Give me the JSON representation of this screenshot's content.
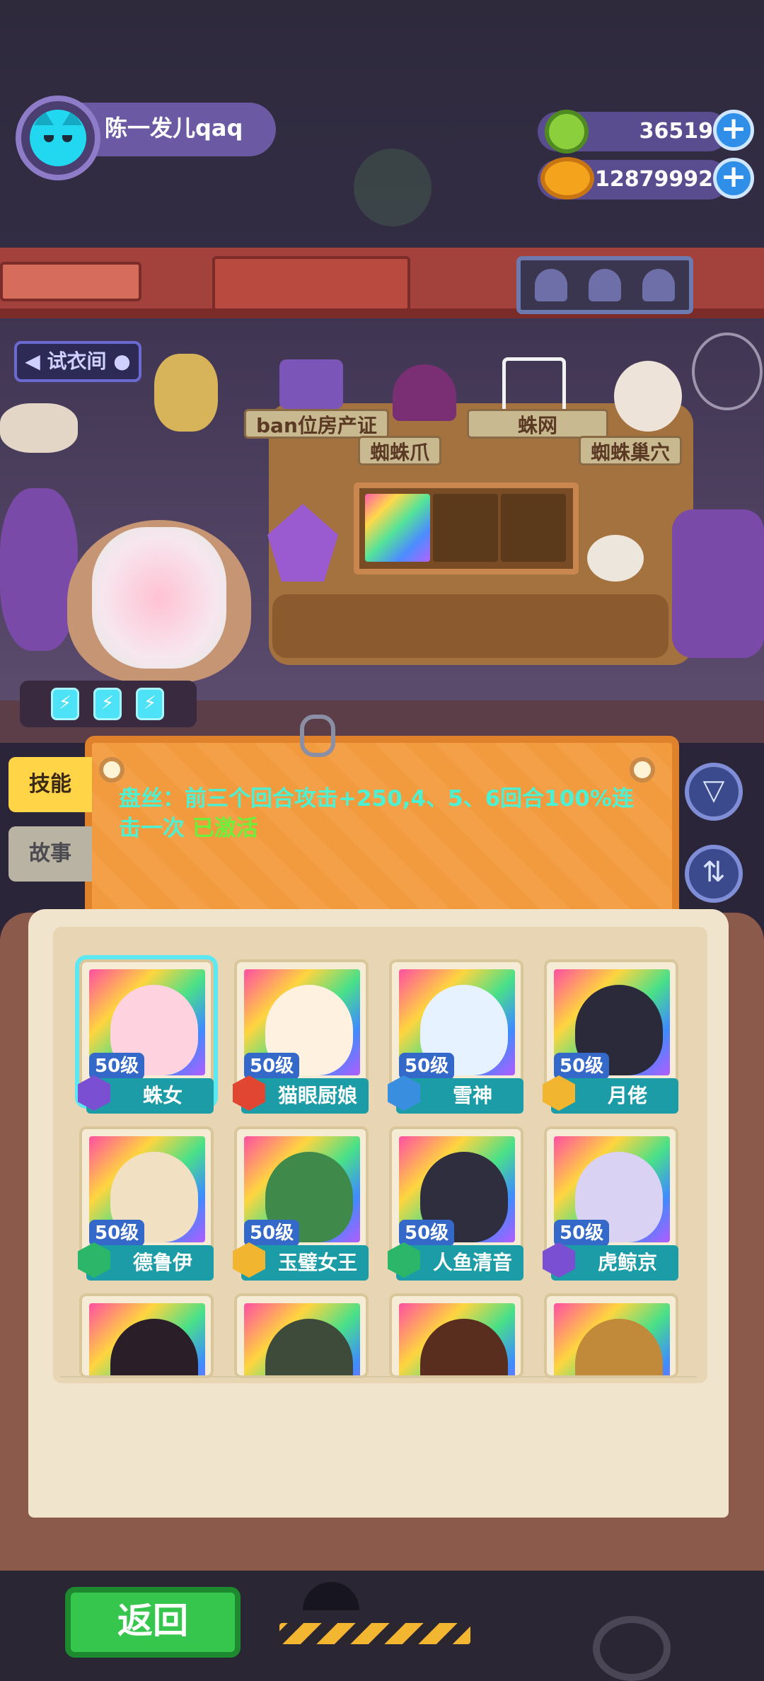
{
  "player": {
    "name": "陈一发儿qaq"
  },
  "currency": {
    "gems": "36519",
    "coins": "12879992",
    "plus_symbol": "+"
  },
  "shop": {
    "fitting_room_label": "试衣间",
    "items": [
      {
        "label": "ban位房产证"
      },
      {
        "label": "蜘蛛爪"
      },
      {
        "label": "蛛网"
      },
      {
        "label": "蜘蛛巢穴"
      }
    ]
  },
  "energy": {
    "symbol": "⚡"
  },
  "side_tabs": {
    "skill": "技能",
    "story": "故事"
  },
  "skill": {
    "description": "盘丝：前三个回合攻击+250,4、5、6回合100%连击一次",
    "status": "已激活"
  },
  "controls": {
    "filter_icon": "filter-icon",
    "sort_icon": "sort-icon"
  },
  "roster": [
    {
      "level": "50级",
      "name": "蛛女",
      "rank_color": "#7a4fd1",
      "face": "#ffd2df"
    },
    {
      "level": "50级",
      "name": "猫眼厨娘",
      "rank_color": "#e04632",
      "face": "#fff1e0"
    },
    {
      "level": "50级",
      "name": "雪神",
      "rank_color": "#3a8ee0",
      "face": "#e6f2ff"
    },
    {
      "level": "50级",
      "name": "月佬",
      "rank_color": "#f2b530",
      "face": "#2a2a3a"
    },
    {
      "level": "50级",
      "name": "德鲁伊",
      "rank_color": "#2cb66a",
      "face": "#f2e0c2"
    },
    {
      "level": "50级",
      "name": "玉璧女王",
      "rank_color": "#f2b530",
      "face": "#3f8a4a"
    },
    {
      "level": "50级",
      "name": "人鱼清音",
      "rank_color": "#2cb66a",
      "face": "#2e2e3e"
    },
    {
      "level": "50级",
      "name": "虎鲸京",
      "rank_color": "#7a4fd1",
      "face": "#d9d2f2"
    }
  ],
  "roster_partial": [
    {
      "face": "#2a1e28"
    },
    {
      "face": "#3e4a3a"
    },
    {
      "face": "#5a2e1e"
    },
    {
      "face": "#c08a3a"
    }
  ],
  "bottom": {
    "back_label": "返回"
  }
}
